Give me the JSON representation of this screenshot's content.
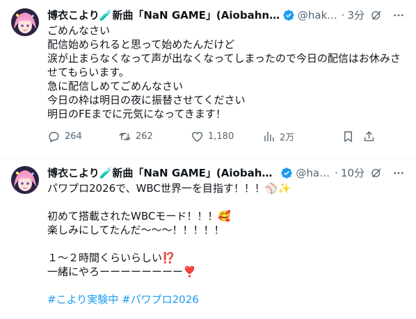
{
  "tweets": [
    {
      "display_name": "博衣こより🧪新曲「NaN GAME」(Aiobahn +81...",
      "handle": "@haku...",
      "separator": "·",
      "time": "3分",
      "text": "ごめんなさい\n配信始められると思って始めたんだけど\n涙が止まらなくなって声が出なくなってしまったので今日の配信はお休みさせてもらいます。\n急に配信しめてごめんなさい\n今日の枠は明日の夜に振替させてください\n明日のFEまでに元気になってきます！",
      "hashtags": "",
      "stats": {
        "replies": "264",
        "retweets": "262",
        "likes": "1,180",
        "views": "2万"
      }
    },
    {
      "display_name": "博衣こより🧪新曲「NaN GAME」(Aiobahn +8...",
      "handle": "@hak...",
      "separator": "·",
      "time": "10分",
      "text": "パワプロ2026で、WBC世界一を目指す！！！⚾✨\n\n初めて搭載されたWBCモード！！！🥰\n楽しみにしてたんだ〜〜〜！！！！！\n\n１〜２時間くらいらしい⁉️\n一緒にやろーーーーーーーー❣️",
      "hashtags": "#こより実験中 #パワプロ2026"
    }
  ],
  "colors": {
    "text": "#0f1419",
    "secondary": "#536471",
    "link": "#1d9bf0",
    "verified": "#1d9bf0",
    "divider": "#eff3f4"
  },
  "icons": [
    "verified-badge-icon",
    "grok-icon",
    "more-icon",
    "reply-icon",
    "retweet-icon",
    "like-icon",
    "views-icon",
    "bookmark-icon",
    "share-icon"
  ]
}
